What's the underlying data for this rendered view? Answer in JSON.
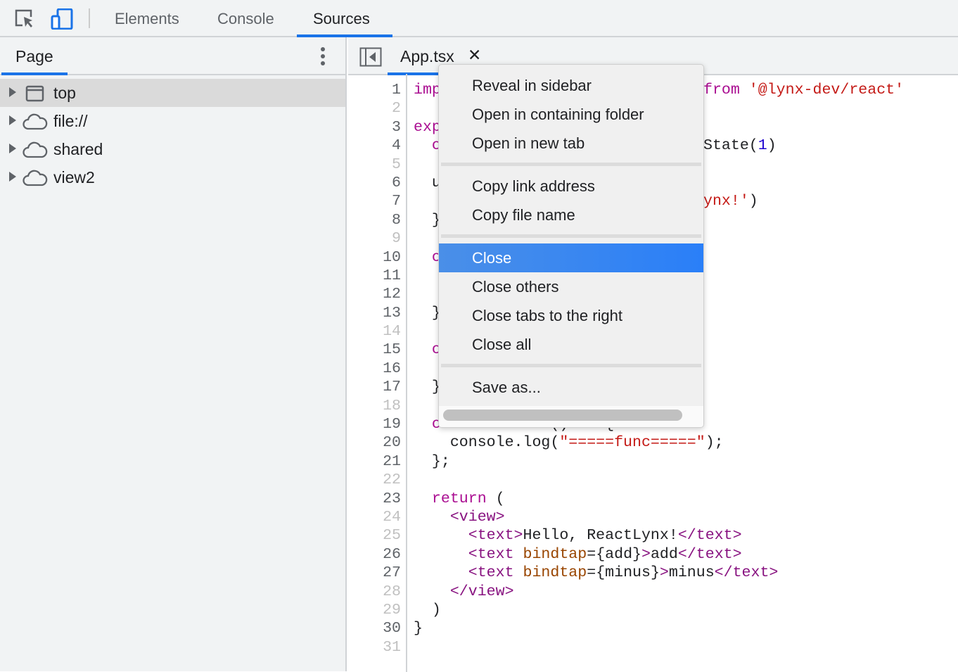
{
  "toolbar": {
    "icons": [
      "inspect-element-icon",
      "device-toggle-icon"
    ],
    "tabs": [
      "Elements",
      "Console",
      "Sources"
    ],
    "active_tab": "Sources"
  },
  "navigator": {
    "title": "Page",
    "items": [
      {
        "label": "top",
        "icon": "frame-icon",
        "selected": true
      },
      {
        "label": "file://",
        "icon": "cloud-icon"
      },
      {
        "label": "shared",
        "icon": "cloud-icon"
      },
      {
        "label": "view2",
        "icon": "cloud-icon"
      }
    ]
  },
  "editor": {
    "file_tab": "App.tsx",
    "close_glyph": "✕",
    "lines": [
      {
        "n": "1",
        "l": [
          [
            "imp",
            "k"
          ]
        ],
        "r": [
          [
            "from ",
            "k"
          ],
          [
            "'@lynx-dev/react'",
            "s"
          ]
        ]
      },
      {
        "n": "2",
        "dim": true
      },
      {
        "n": "3",
        "l": [
          [
            "exp",
            "k"
          ]
        ]
      },
      {
        "n": "4",
        "l": [
          [
            "  c",
            "k"
          ]
        ],
        "r": [
          [
            "State(",
            "p"
          ],
          [
            "1",
            "n"
          ],
          [
            ")",
            "p"
          ]
        ]
      },
      {
        "n": "5",
        "dim": true
      },
      {
        "n": "6",
        "l": [
          [
            "  u",
            "p"
          ]
        ]
      },
      {
        "n": "7",
        "r": [
          [
            "ynx!'",
            "s"
          ],
          [
            ")",
            "p"
          ]
        ]
      },
      {
        "n": "8",
        "l": [
          [
            "  }",
            "p"
          ]
        ]
      },
      {
        "n": "9",
        "dim": true
      },
      {
        "n": "10",
        "l": [
          [
            "  c",
            "k"
          ]
        ]
      },
      {
        "n": "11"
      },
      {
        "n": "12"
      },
      {
        "n": "13",
        "l": [
          [
            "  }",
            "p"
          ]
        ]
      },
      {
        "n": "14",
        "dim": true
      },
      {
        "n": "15",
        "l": [
          [
            "  c",
            "k"
          ]
        ]
      },
      {
        "n": "16"
      },
      {
        "n": "17",
        "l": [
          [
            "  }",
            "p"
          ]
        ]
      },
      {
        "n": "18",
        "dim": true
      },
      {
        "n": "19",
        "l": [
          [
            "  const func ",
            "k"
          ],
          [
            "= () => {",
            "p"
          ]
        ]
      },
      {
        "n": "20",
        "l": [
          [
            "    console.log(",
            "p"
          ],
          [
            "\"=====func=====\"",
            "s"
          ],
          [
            ");",
            "p"
          ]
        ]
      },
      {
        "n": "21",
        "l": [
          [
            "  };",
            "p"
          ]
        ]
      },
      {
        "n": "22",
        "dim": true
      },
      {
        "n": "23",
        "l": [
          [
            "  return",
            "k"
          ],
          [
            " (",
            "p"
          ]
        ]
      },
      {
        "n": "24",
        "dim": true,
        "l": [
          [
            "    <view>",
            "g"
          ]
        ]
      },
      {
        "n": "25",
        "dim": true,
        "l": [
          [
            "      <text>",
            "g"
          ],
          [
            "Hello, ReactLynx!",
            "p"
          ],
          [
            "</text>",
            "g"
          ]
        ]
      },
      {
        "n": "26",
        "l": [
          [
            "      <text ",
            "g"
          ],
          [
            "bindtap",
            "a"
          ],
          [
            "={add}",
            "p"
          ],
          [
            ">",
            "g"
          ],
          [
            "add",
            "p"
          ],
          [
            "</text>",
            "g"
          ]
        ]
      },
      {
        "n": "27",
        "l": [
          [
            "      <text ",
            "g"
          ],
          [
            "bindtap",
            "a"
          ],
          [
            "={minus}",
            "p"
          ],
          [
            ">",
            "g"
          ],
          [
            "minus",
            "p"
          ],
          [
            "</text>",
            "g"
          ]
        ]
      },
      {
        "n": "28",
        "dim": true,
        "l": [
          [
            "    </view>",
            "g"
          ]
        ]
      },
      {
        "n": "29",
        "dim": true,
        "l": [
          [
            "  )",
            "p"
          ]
        ]
      },
      {
        "n": "30",
        "l": [
          [
            "}",
            "p"
          ]
        ]
      },
      {
        "n": "31",
        "dim": true
      }
    ]
  },
  "context_menu": {
    "groups": [
      [
        "Reveal in sidebar",
        "Open in containing folder",
        "Open in new tab"
      ],
      [
        "Copy link address",
        "Copy file name"
      ],
      [
        "Close",
        "Close others",
        "Close tabs to the right",
        "Close all"
      ],
      [
        "Save as..."
      ]
    ],
    "highlighted": "Close",
    "highlight_color": "#2a7ff8"
  },
  "colors": {
    "accent": "#1a73e8",
    "keyword": "#aa0d91",
    "string": "#c41a16",
    "number": "#1c00cf",
    "attribute": "#994500",
    "tag": "#881280"
  }
}
